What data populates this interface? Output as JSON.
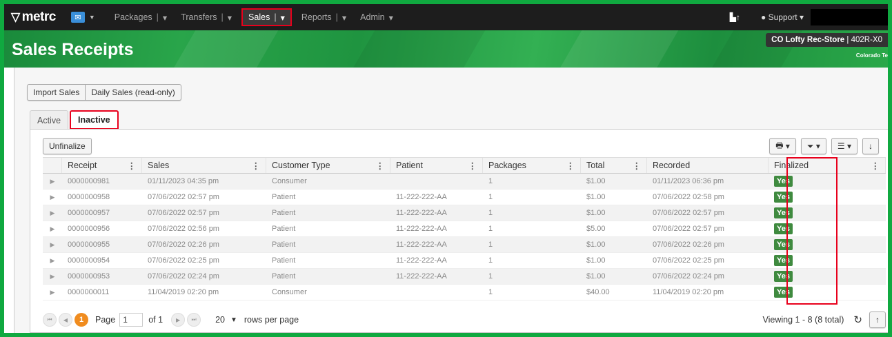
{
  "nav": {
    "logo": "metrc",
    "items": [
      {
        "label": "Packages"
      },
      {
        "label": "Transfers"
      },
      {
        "label": "Sales"
      },
      {
        "label": "Reports"
      },
      {
        "label": "Admin"
      }
    ],
    "support": "Support"
  },
  "header": {
    "title": "Sales Receipts",
    "facility_name": "CO Lofty Rec-Store",
    "facility_license": "| 402R-X0",
    "state": "Colorado Te"
  },
  "actions": {
    "import": "Import Sales",
    "daily": "Daily Sales (read-only)"
  },
  "tabs": {
    "active": "Active",
    "inactive": "Inactive"
  },
  "toolbar": {
    "unfinalize": "Unfinalize"
  },
  "table": {
    "headers": [
      "Receipt",
      "Sales",
      "Customer Type",
      "Patient",
      "Packages",
      "Total",
      "Recorded",
      "Finalized"
    ],
    "rows": [
      [
        "0000000981",
        "01/11/2023 04:35 pm",
        "Consumer",
        "",
        "1",
        "$1.00",
        "01/11/2023 06:36 pm",
        "Yes"
      ],
      [
        "0000000958",
        "07/06/2022 02:57 pm",
        "Patient",
        "11-222-222-AA",
        "1",
        "$1.00",
        "07/06/2022 02:58 pm",
        "Yes"
      ],
      [
        "0000000957",
        "07/06/2022 02:57 pm",
        "Patient",
        "11-222-222-AA",
        "1",
        "$1.00",
        "07/06/2022 02:57 pm",
        "Yes"
      ],
      [
        "0000000956",
        "07/06/2022 02:56 pm",
        "Patient",
        "11-222-222-AA",
        "1",
        "$5.00",
        "07/06/2022 02:57 pm",
        "Yes"
      ],
      [
        "0000000955",
        "07/06/2022 02:26 pm",
        "Patient",
        "11-222-222-AA",
        "1",
        "$1.00",
        "07/06/2022 02:26 pm",
        "Yes"
      ],
      [
        "0000000954",
        "07/06/2022 02:25 pm",
        "Patient",
        "11-222-222-AA",
        "1",
        "$1.00",
        "07/06/2022 02:25 pm",
        "Yes"
      ],
      [
        "0000000953",
        "07/06/2022 02:24 pm",
        "Patient",
        "11-222-222-AA",
        "1",
        "$1.00",
        "07/06/2022 02:24 pm",
        "Yes"
      ],
      [
        "0000000011",
        "11/04/2019 02:20 pm",
        "Consumer",
        "",
        "1",
        "$40.00",
        "11/04/2019 02:20 pm",
        "Yes"
      ]
    ]
  },
  "pager": {
    "current": "1",
    "page_label": "Page",
    "page_value": "1",
    "of_label": "of 1",
    "page_size": "20",
    "rows_label": "rows per page",
    "viewing": "Viewing 1 - 8 (8 total)"
  },
  "colors": {
    "accent": "#e8001c",
    "header_green": "#1f9440",
    "badge_green": "#3f8a3f",
    "pager_orange": "#f08c1f"
  }
}
